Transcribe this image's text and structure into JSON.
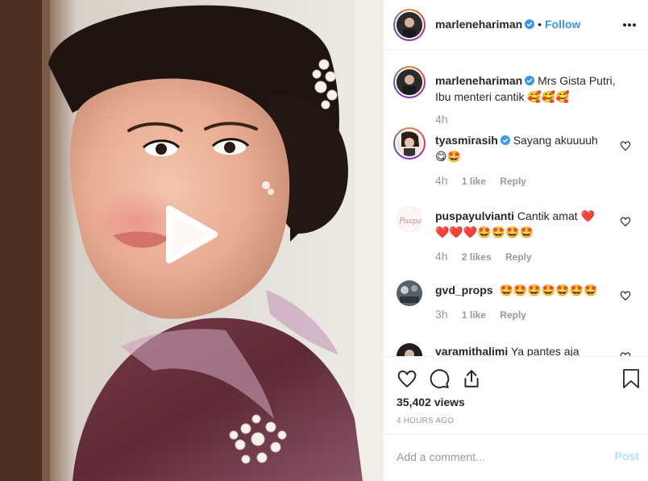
{
  "post": {
    "author": "marlenehariman",
    "follow_label": "Follow",
    "separator": "•",
    "caption_text": "Mrs Gista Putri, Ibu menteri cantik",
    "caption_emoji": "🥰🥰🥰",
    "caption_time": "4h",
    "views": "35,402 views",
    "timestamp": "4 HOURS AGO"
  },
  "comments": [
    {
      "user": "tyasmirasih",
      "verified": true,
      "text": "Sayang akuuuuh",
      "emoji": "😋🤩",
      "time": "4h",
      "likes": "1 like",
      "reply": "Reply"
    },
    {
      "user": "puspayulvianti",
      "verified": false,
      "text": "Cantik amat",
      "emoji": "❤️",
      "line2": "❤️❤️❤️🤩🤩🤩🤩",
      "time": "4h",
      "likes": "2 likes",
      "reply": "Reply"
    },
    {
      "user": "gvd_props",
      "verified": false,
      "text": "",
      "emoji": "🤩🤩🤩🤩🤩🤩🤩",
      "time": "3h",
      "likes": "1 like",
      "reply": "Reply"
    },
    {
      "user": "varamithalimi",
      "verified": false,
      "text": "Ya pantes aja",
      "emoji": ""
    }
  ],
  "add_comment": {
    "placeholder": "Add a comment...",
    "post_label": "Post"
  },
  "avatar_text": {
    "puspa": "Puspa"
  },
  "colors": {
    "link": "#3897f0",
    "post_disabled": "#b2dffc",
    "muted": "#999999",
    "verified": "#3897f0"
  },
  "icons": [
    "play-icon",
    "verified-icon",
    "more-icon",
    "heart-icon",
    "comment-icon",
    "share-icon",
    "bookmark-icon"
  ]
}
